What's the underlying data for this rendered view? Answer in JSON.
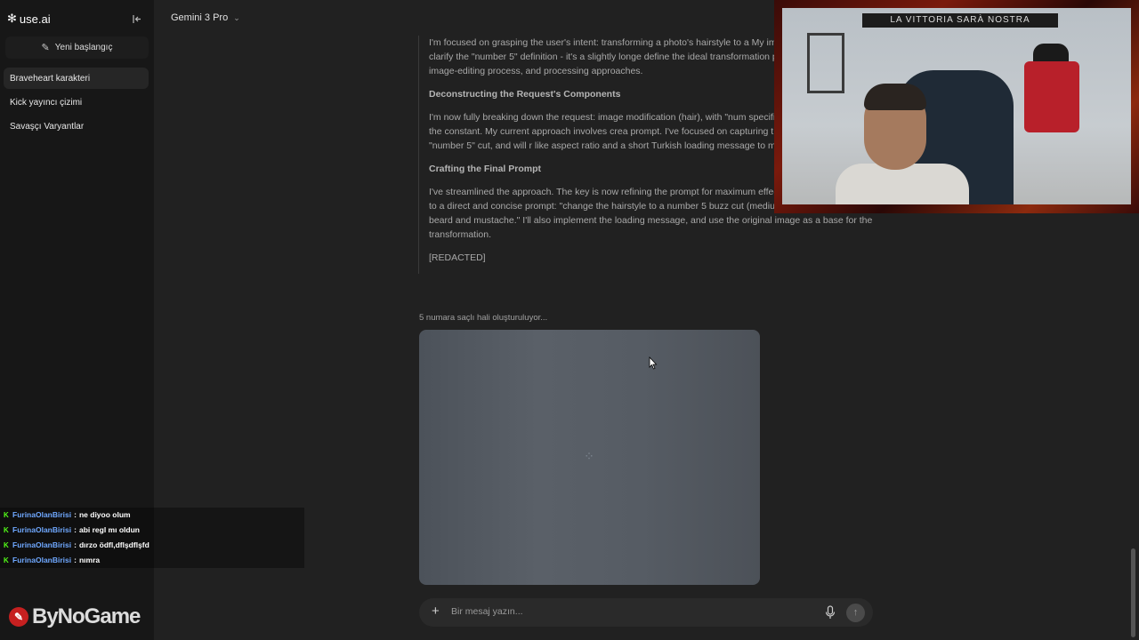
{
  "app": {
    "logo_text": "use.ai",
    "logo_icon": "sparkle-icon"
  },
  "sidebar": {
    "new_chat_label": "Yeni başlangıç",
    "items": [
      {
        "label": "Braveheart karakteri",
        "active": true
      },
      {
        "label": "Kick yayıncı çizimi",
        "active": false
      },
      {
        "label": "Savaşçı Varyantlar",
        "active": false
      }
    ]
  },
  "topbar": {
    "model": "Gemini 3 Pro"
  },
  "thinking": {
    "p1": "I'm focused on grasping the user's intent: transforming a photo's hairstyle to a My immediate plan is to clarify the \"number 5\" definition - it's a slightly longe define the ideal transformation parameters for the image-editing process, and processing approaches.",
    "h1": "Deconstructing the Request's Components",
    "p2": "I'm now fully breaking down the request: image modification (hair), with \"num specific length. The photo is the constant. My current approach involves crea prompt. I've focused on capturing the essence of a \"number 5\" cut, and will r like aspect ratio and a short Turkish loading message to make the process mo",
    "h2": "Crafting the Final Prompt",
    "p3": "I've streamlined the approach. The key is now refining the prompt for maximum effectiveness. I've switched to a direct and concise prompt: \"change the hairstyle to a number 5 buzz cut (medium short length), keep beard and mustache.\" I'll also implement the loading message, and use the original image as a base for the transformation.",
    "redacted": "[REDACTED]"
  },
  "status_text": "5 numara saçlı hali oluşturuluyor...",
  "composer": {
    "placeholder": "Bir mesaj yazın..."
  },
  "webcam": {
    "banner_text": "LA VITTORIA SARÀ NOSTRA"
  },
  "stream_chat": [
    {
      "user": "FurinaOlanBirisi",
      "message": "ne diyoo olum"
    },
    {
      "user": "FurinaOlanBirisi",
      "message": "abi regl mı oldun"
    },
    {
      "user": "FurinaOlanBirisi",
      "message": "dırzo ödfl,dflşdflşfd"
    },
    {
      "user": "FurinaOlanBirisi",
      "message": "nımra"
    }
  ],
  "watermark": {
    "text": "ByNoGame"
  },
  "colors": {
    "background": "#212121",
    "sidebar": "#171717",
    "chat_user": "#6fa8ff",
    "kick_badge": "#53fc18"
  }
}
